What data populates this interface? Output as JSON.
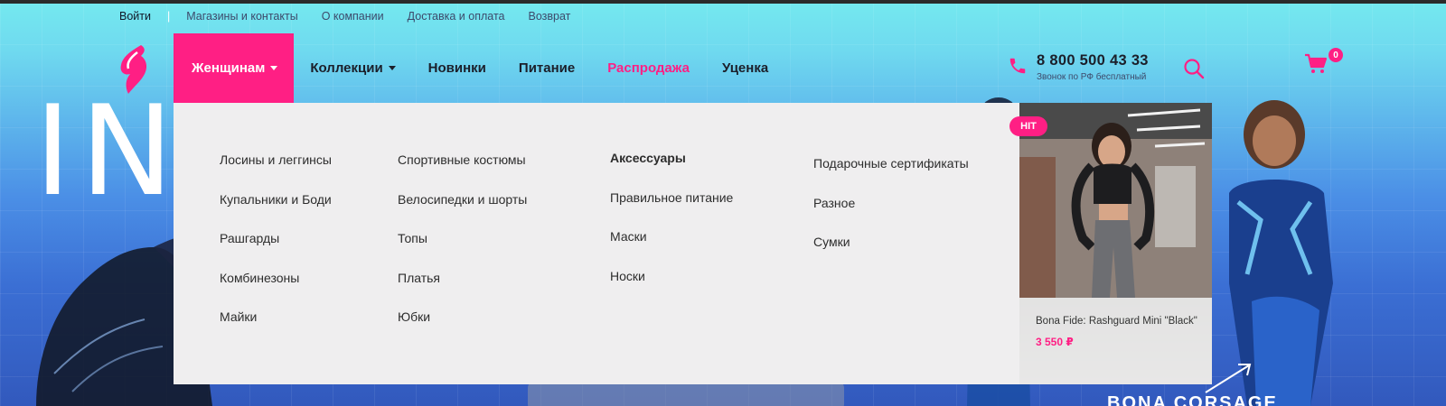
{
  "utility": {
    "login": "Войти",
    "separator": "|",
    "links": [
      "Магазины и контакты",
      "О компании",
      "Доставка и оплата",
      "Возврат"
    ]
  },
  "nav": {
    "items": [
      {
        "label": "Женщинам",
        "active": true,
        "has_caret": true
      },
      {
        "label": "Коллекции",
        "active": false,
        "has_caret": true
      },
      {
        "label": "Новинки",
        "active": false,
        "has_caret": false
      },
      {
        "label": "Питание",
        "active": false,
        "has_caret": false
      },
      {
        "label": "Распродажа",
        "active": false,
        "has_caret": false,
        "highlight": true
      },
      {
        "label": "Уценка",
        "active": false,
        "has_caret": false
      }
    ]
  },
  "phone": {
    "number": "8 800 500 43 33",
    "note": "Звонок по РФ бесплатный"
  },
  "cart": {
    "count": "0"
  },
  "dropdown": {
    "col1": [
      "Лосины и леггинсы",
      "Купальники и Боди",
      "Рашгарды",
      "Комбинезоны",
      "Майки"
    ],
    "col2": [
      "Спортивные костюмы",
      "Велосипедки и шорты",
      "Топы",
      "Платья",
      "Юбки"
    ],
    "col3": [
      "Аксессуары",
      "Правильное питание",
      "Маски",
      "Носки"
    ],
    "col4": [
      "Подарочные сертификаты",
      "Разное",
      "Сумки"
    ]
  },
  "promo": {
    "badge": "HIT",
    "title": "Bona Fide: Rashguard Mini \"Black\"",
    "price": "3 550 ₽"
  },
  "hero": {
    "big_text": "IN",
    "bottom_label": "BONA CORSAGE"
  },
  "colors": {
    "accent": "#ff1f84",
    "dropdown_bg": "#efeeef",
    "text_dark": "#1b1f2a"
  },
  "icons": [
    "logo-icon",
    "phone-icon",
    "search-icon",
    "cart-icon",
    "arrow-icon"
  ]
}
